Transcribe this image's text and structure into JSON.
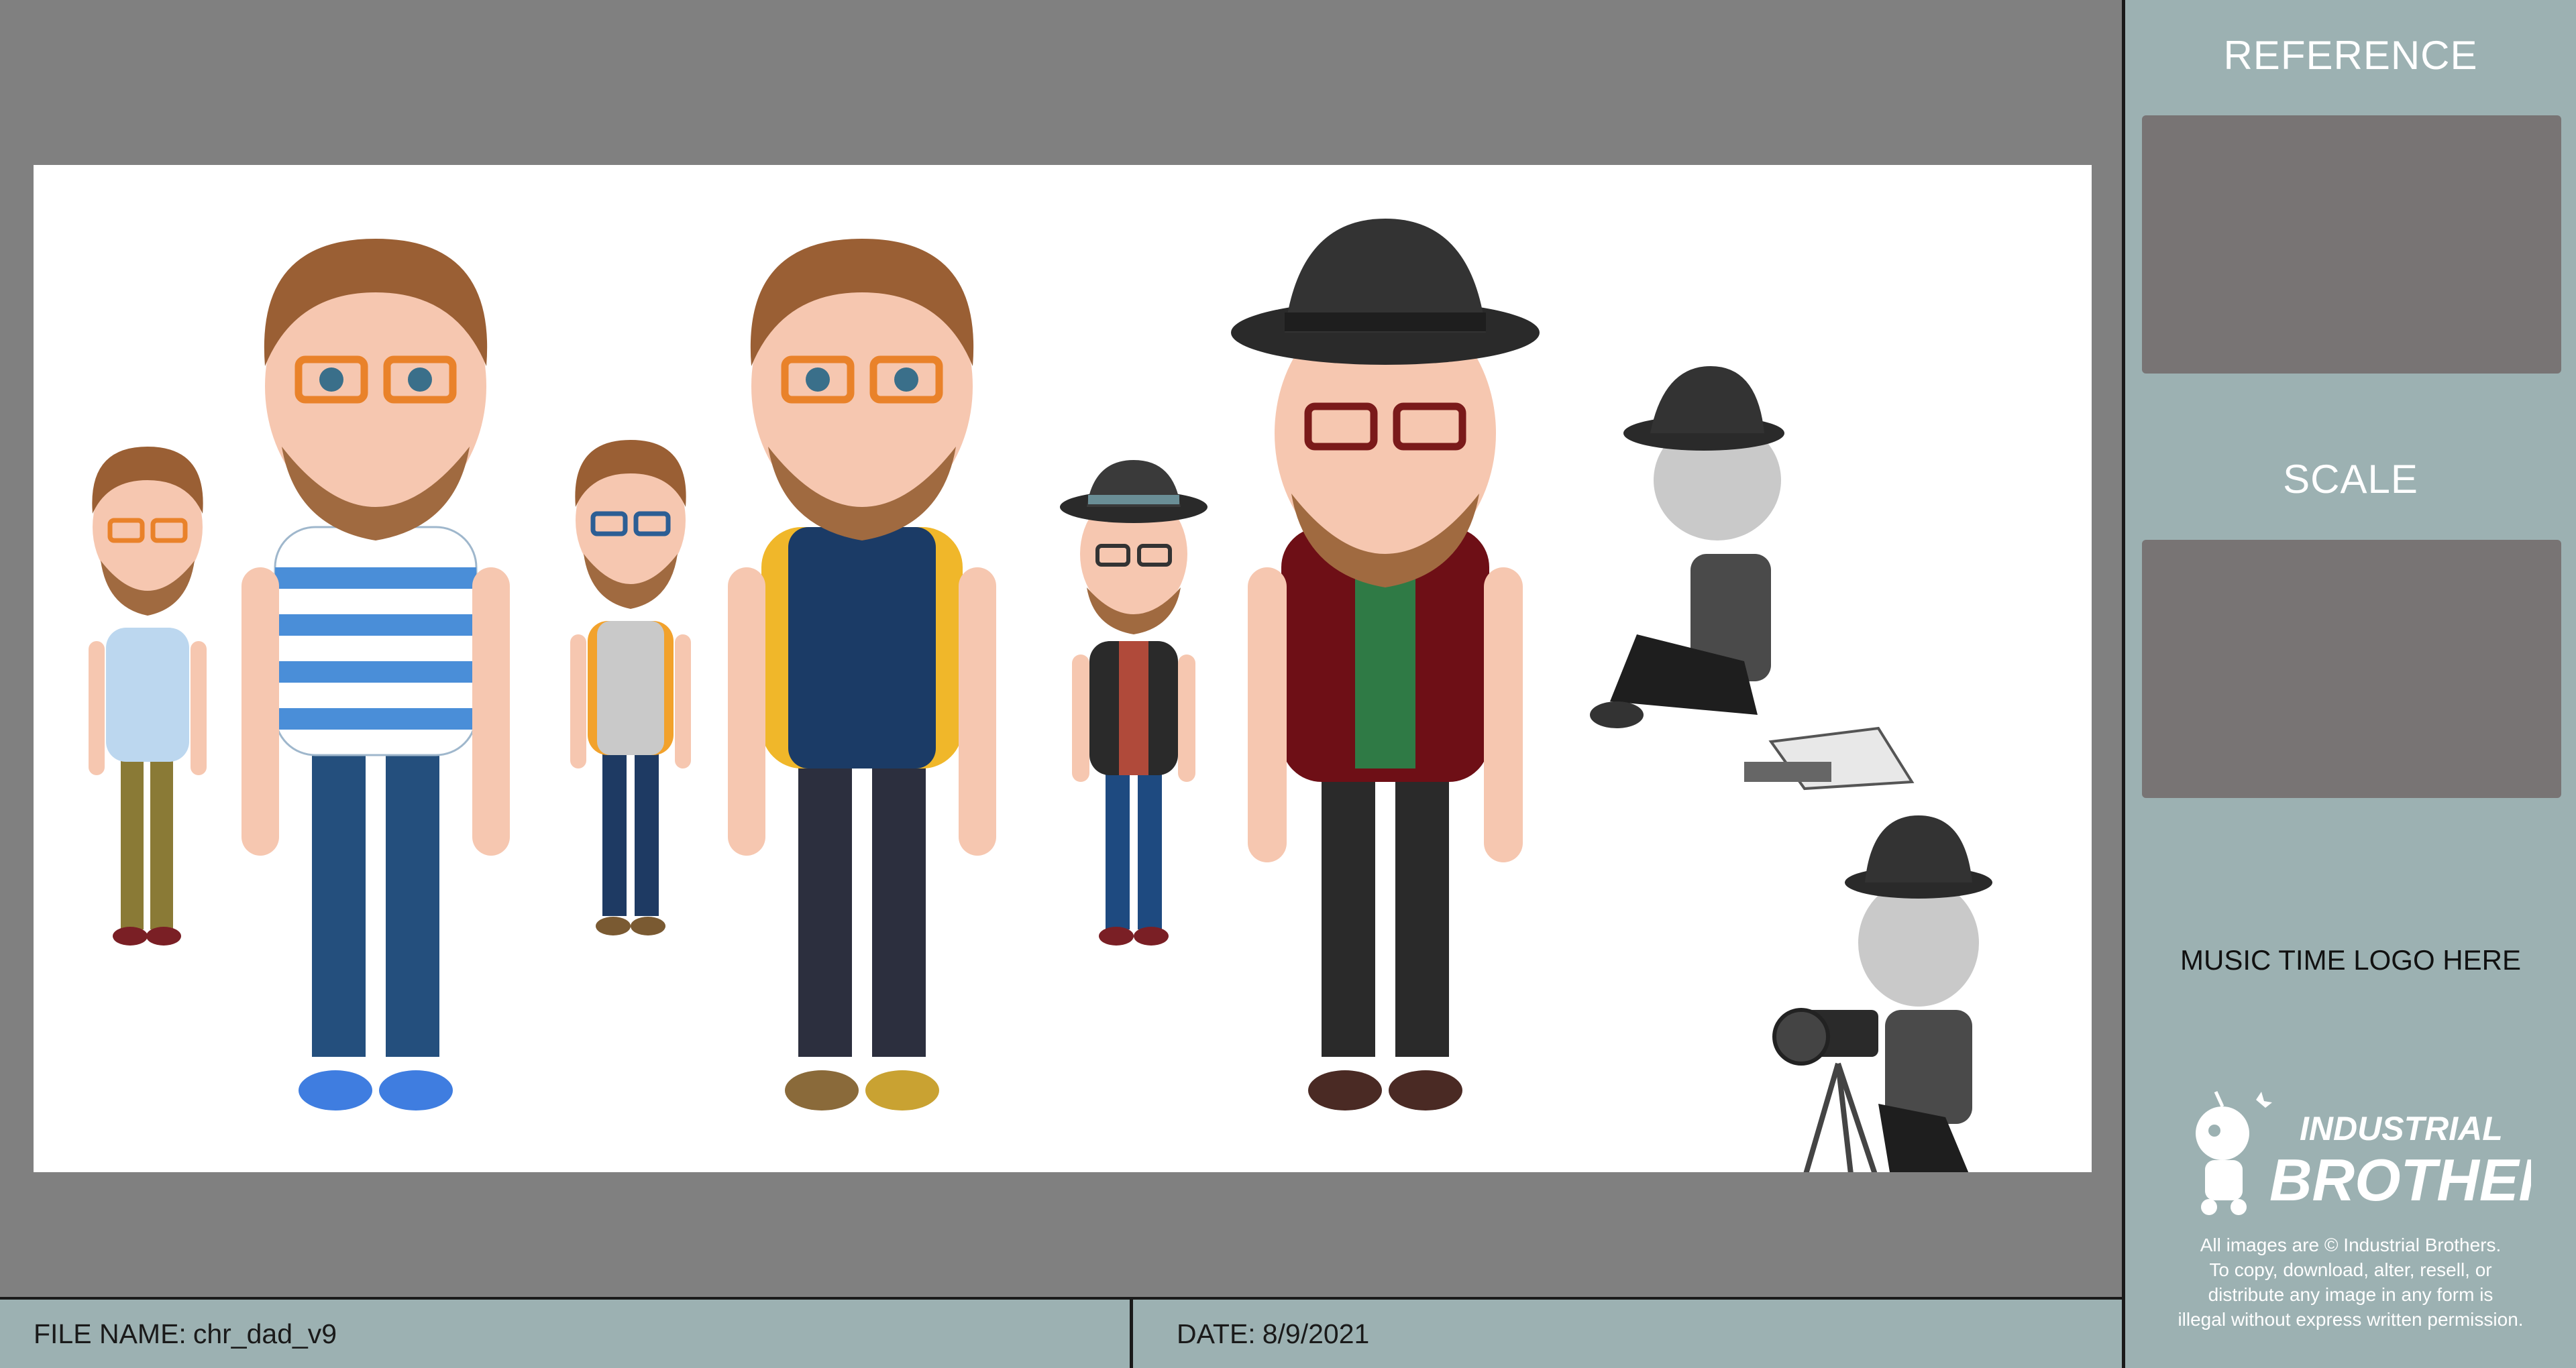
{
  "sidebar": {
    "reference_label": "REFERENCE",
    "scale_label": "SCALE",
    "logo_placeholder": "MUSIC TIME LOGO HERE",
    "brand_line1": "INDUSTRIAL",
    "brand_line2": "BROTHERS",
    "copyright_lines": [
      "All images are © Industrial Brothers.",
      "To copy, download, alter, resell, or",
      "distribute any image in any form is",
      "illegal without express written permission."
    ]
  },
  "footer": {
    "file_label": "FILE NAME:",
    "file_value": "chr_dad_v9",
    "date_label": "DATE:",
    "date_value": "8/9/2021"
  },
  "colors": {
    "sidebar_bg": "#9cb1b2",
    "frame_bg": "#808080",
    "placeholder_box": "#787474",
    "canvas_bg": "#ffffff"
  }
}
